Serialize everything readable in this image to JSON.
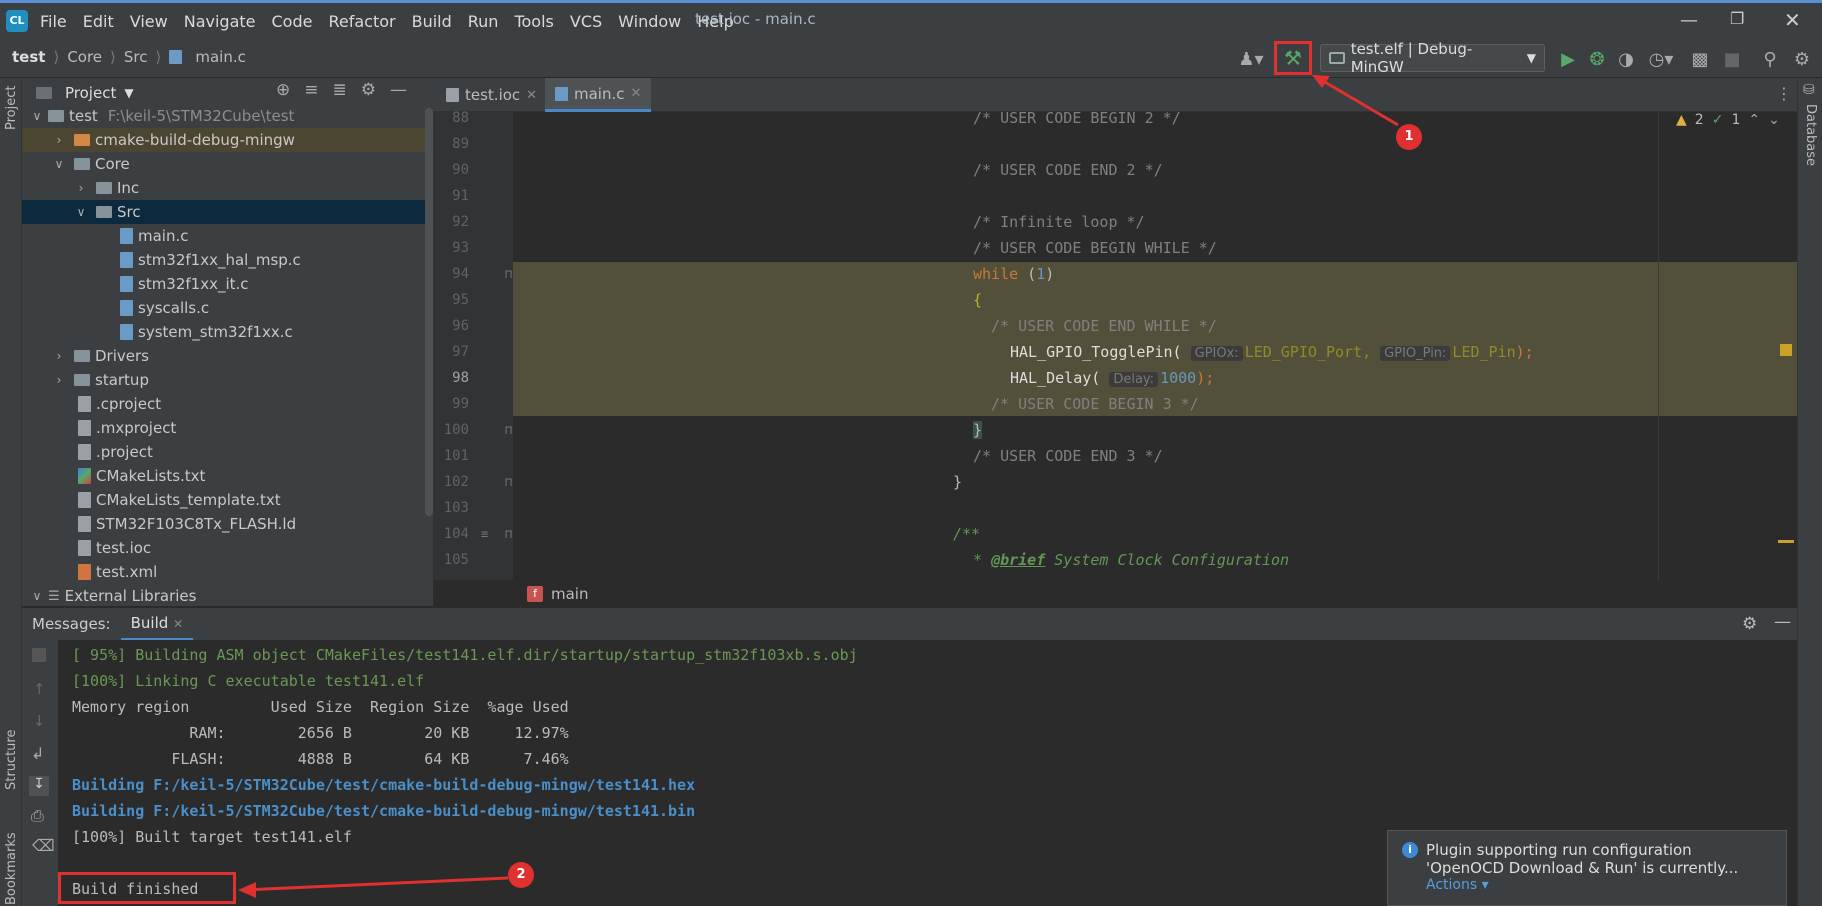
{
  "menu": [
    "File",
    "Edit",
    "View",
    "Navigate",
    "Code",
    "Refactor",
    "Build",
    "Run",
    "Tools",
    "VCS",
    "Window",
    "Help"
  ],
  "window_title": "test.ioc - main.c",
  "breadcrumb": [
    "test",
    "Core",
    "Src",
    "main.c"
  ],
  "run_config": "test.elf | Debug-MinGW",
  "project_panel_title": "Project",
  "tree": [
    {
      "label": "test",
      "path": "F:\\keil-5\\STM32Cube\\test"
    },
    {
      "label": "cmake-build-debug-mingw"
    },
    {
      "label": "Core"
    },
    {
      "label": "Inc"
    },
    {
      "label": "Src"
    },
    {
      "label": "main.c"
    },
    {
      "label": "stm32f1xx_hal_msp.c"
    },
    {
      "label": "stm32f1xx_it.c"
    },
    {
      "label": "syscalls.c"
    },
    {
      "label": "system_stm32f1xx.c"
    },
    {
      "label": "Drivers"
    },
    {
      "label": "startup"
    },
    {
      "label": ".cproject"
    },
    {
      "label": ".mxproject"
    },
    {
      "label": ".project"
    },
    {
      "label": "CMakeLists.txt"
    },
    {
      "label": "CMakeLists_template.txt"
    },
    {
      "label": "STM32F103C8Tx_FLASH.ld"
    },
    {
      "label": "test.ioc"
    },
    {
      "label": "test.xml"
    },
    {
      "label": "External Libraries"
    }
  ],
  "tabs": [
    "test.ioc",
    "main.c"
  ],
  "line_numbers": [
    "88",
    "89",
    "90",
    "91",
    "92",
    "93",
    "94",
    "95",
    "96",
    "97",
    "98",
    "99",
    "100",
    "101",
    "102",
    "103",
    "104",
    "105"
  ],
  "code": {
    "l88": "/* USER CODE BEGIN 2 */",
    "l90": "/* USER CODE END 2 */",
    "l92": "/* Infinite loop */",
    "l93": "/* USER CODE BEGIN WHILE */",
    "l94_kw": "while",
    "l94_open": " (",
    "l94_num": "1",
    "l94_close": ")",
    "l95": "{",
    "l96": "/* USER CODE END WHILE */",
    "l97_fn": "HAL_GPIO_TogglePin(",
    "l97_hint1": "GPIOx:",
    "l97_arg1": "LED_GPIO_Port,",
    "l97_hint2": "GPIO_Pin:",
    "l97_arg2": "LED_Pin",
    "l97_end": ");",
    "l98_fn": "HAL_Delay(",
    "l98_hint": "Delay:",
    "l98_num": "1000",
    "l98_end": ");",
    "l99": "/* USER CODE BEGIN 3 */",
    "l100": "}",
    "l101": "/* USER CODE END 3 */",
    "l102": "}",
    "l104": "/**",
    "l105_star": "* ",
    "l105_tag": "@brief",
    "l105_text": " System Clock Configuration"
  },
  "inspection": {
    "warnings": "2",
    "ok": "1"
  },
  "editor_breadcrumb": "main",
  "func_badge": "f",
  "messages_label": "Messages:",
  "build_tab": "Build",
  "console": [
    "[ 95%] Building ASM object CMakeFiles/test141.elf.dir/startup/startup_stm32f103xb.s.obj",
    "[100%] Linking C executable test141.elf",
    "Memory region         Used Size  Region Size  %age Used",
    "             RAM:        2656 B        20 KB     12.97%",
    "           FLASH:        4888 B        64 KB      7.46%",
    "Building F:/keil-5/STM32Cube/test/cmake-build-debug-mingw/test141.hex",
    "Building F:/keil-5/STM32Cube/test/cmake-build-debug-mingw/test141.bin",
    "[100%] Built target test141.elf",
    "Build finished"
  ],
  "notification": {
    "text1": "Plugin supporting run configuration",
    "text2": "'OpenOCD Download & Run' is currently...",
    "action": "Actions"
  },
  "side_labels": {
    "project": "Project",
    "structure": "Structure",
    "bookmarks": "Bookmarks",
    "database": "Database"
  },
  "callouts": [
    "1",
    "2"
  ],
  "colors": {
    "accent": "#4a88c7",
    "callout": "#e03030",
    "highlight": "#52503a"
  }
}
